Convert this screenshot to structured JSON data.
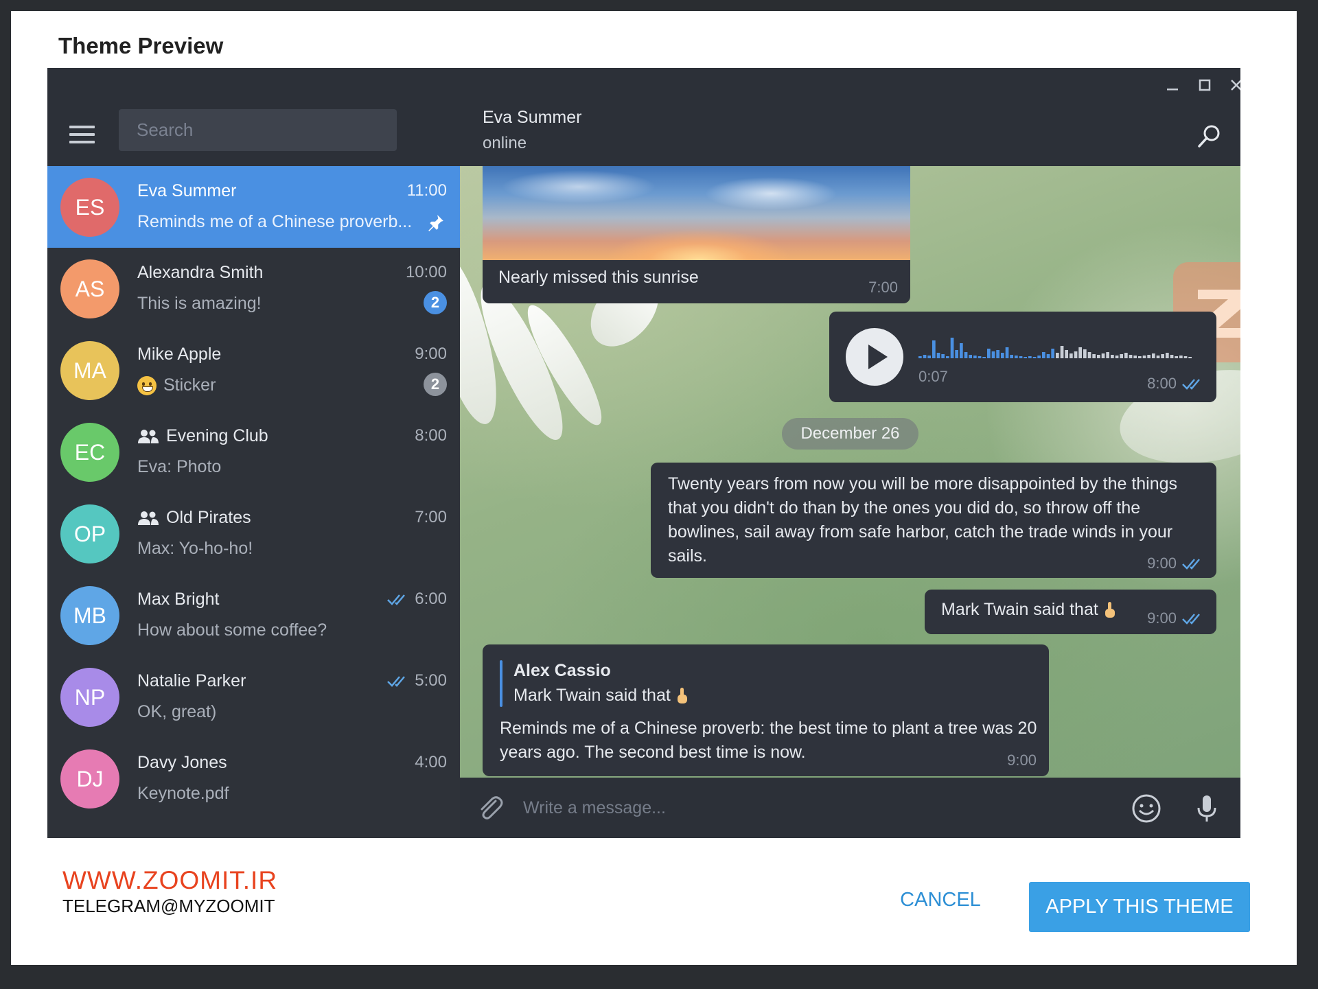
{
  "dialog": {
    "title": "Theme Preview",
    "cancel_label": "CANCEL",
    "apply_label": "APPLY THIS THEME"
  },
  "watermark": {
    "url": "WWW.ZOOMIT.IR",
    "telegram": "TELEGRAM@MYZOOMIT",
    "url_color": "#e8431f"
  },
  "sidebar": {
    "search_placeholder": "Search",
    "chats": [
      {
        "initials": "ES",
        "name": "Eva Summer",
        "time": "11:00",
        "preview": "Reminds me of a Chinese proverb...",
        "color": "#e06a6a",
        "active": true,
        "pinned": true
      },
      {
        "initials": "AS",
        "name": "Alexandra Smith",
        "time": "10:00",
        "preview": "This is amazing!",
        "color": "#f39a6b",
        "badge": "2",
        "badge_color": "#4a90e2"
      },
      {
        "initials": "MA",
        "name": "Mike Apple",
        "time": "9:00",
        "preview": "Sticker",
        "color": "#e8c35a",
        "badge": "2",
        "badge_color": "#8d939c",
        "preview_icon": "grinning-face-icon"
      },
      {
        "initials": "EC",
        "name": "Evening Club",
        "time": "8:00",
        "preview": "Eva: Photo",
        "color": "#69c96a",
        "group": true
      },
      {
        "initials": "OP",
        "name": "Old Pirates",
        "time": "7:00",
        "preview": "Max: Yo-ho-ho!",
        "color": "#55c7c0",
        "group": true
      },
      {
        "initials": "MB",
        "name": "Max Bright",
        "time": "6:00",
        "preview": "How about some coffee?",
        "color": "#5fa6e6",
        "read": true
      },
      {
        "initials": "NP",
        "name": "Natalie Parker",
        "time": "5:00",
        "preview": "OK, great)",
        "color": "#a88be8",
        "read": true
      },
      {
        "initials": "DJ",
        "name": "Davy Jones",
        "time": "4:00",
        "preview": "Keynote.pdf",
        "color": "#e67bb3"
      }
    ]
  },
  "conversation": {
    "peer_name": "Eva Summer",
    "peer_status": "online",
    "photo_caption": "Nearly missed this sunrise",
    "photo_time": "7:00",
    "voice_duration": "0:07",
    "voice_time": "8:00",
    "date_separator": "December 26",
    "quote_text": "Twenty years from now you will be more disappointed by the things that you didn't do than by the ones you did do, so throw off the bowlines, sail away from safe harbor, catch the trade winds in your sails.",
    "quote_time": "9:00",
    "twain_text": "Mark Twain said that",
    "twain_time": "9:00",
    "reply_author": "Alex Cassio",
    "reply_quote": "Mark Twain said that",
    "reply_text": "Reminds me of a Chinese proverb: the best time to plant a tree was 20 years ago. The second best time is now.",
    "reply_time": "9:00",
    "compose_placeholder": "Write a message..."
  },
  "colors": {
    "accent": "#4a90e2",
    "apply_button": "#3aa0e5",
    "cancel_text": "#2d8fd5",
    "panel_bg": "#2e3239",
    "bubble_bg": "#2f333c"
  }
}
